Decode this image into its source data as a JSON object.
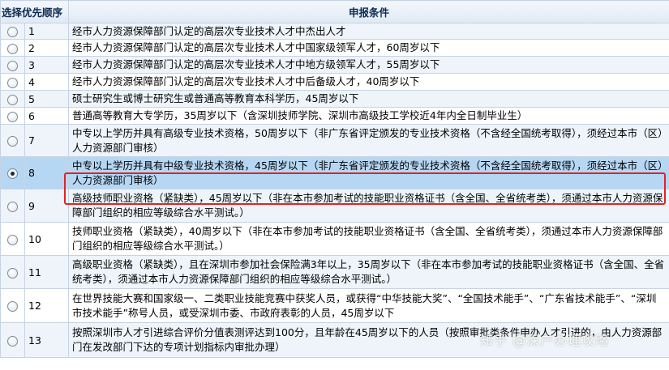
{
  "headers": {
    "select": "选择",
    "order": "优先顺序",
    "conditions": "申报条件"
  },
  "rows": [
    {
      "order": "1",
      "text": "经市人力资源保障部门认定的高层次专业技术人才中杰出人才",
      "selected": false
    },
    {
      "order": "2",
      "text": "经市人力资源保障部门认定的高层次专业技术人才中国家级领军人才，60周岁以下",
      "selected": false
    },
    {
      "order": "3",
      "text": "经市人力资源保障部门认定的高层次专业技术人才中地方级领军人才，55周岁以下",
      "selected": false
    },
    {
      "order": "4",
      "text": "经市人力资源保障部门认定的高层次专业技术人才中后备级人才，40周岁以下",
      "selected": false
    },
    {
      "order": "5",
      "text": "硕士研究生或博士研究生或普通高等教育本科学历，45周岁以下",
      "selected": false
    },
    {
      "order": "6",
      "text": "普通高等教育大专学历，35周岁以下（含深圳技师学院、深圳市高级技工学校近4年内全日制毕业生）",
      "selected": false
    },
    {
      "order": "7",
      "text": "中专以上学历并具有高级专业技术资格，50周岁以下（非广东省评定颁发的专业技术资格（不含经全国统考取得），须经过本市（区）人力资源部门审核）",
      "selected": false
    },
    {
      "order": "8",
      "text": "中专以上学历并具有中级专业技术资格，45周岁以下（非广东省评定颁发的专业技术资格（不含经全国统考取得），须经过本市（区）人力资源部门审核）",
      "selected": true
    },
    {
      "order": "9",
      "text": "高级技师职业资格（紧缺类），45周岁以下（非在本市参加考试的技能职业资格证书（含全国、全省统考类），须通过本市人力资源保障部门组织的相应等级综合水平测试。）",
      "selected": false
    },
    {
      "order": "10",
      "text": "技师职业资格（紧缺类），40周岁以下（非在本市参加考试的技能职业资格证书（含全国、全省统考类），须通过本市人力资源保障部门组织的相应等级综合水平测试。）",
      "selected": false
    },
    {
      "order": "11",
      "text": "高级职业资格（紧缺类），且在深圳市参加社会保险满3年以上，35周岁以下（非在本市参加考试的技能职业资格证书（含全国、全省统考类），须通过本市人力资源保障部门组织的相应等级综合水平测试。）",
      "selected": false
    },
    {
      "order": "12",
      "text": "在世界技能大赛和国家级一、二类职业技能竞赛中获奖人员，或获得“中华技能大奖”、“全国技术能手”、“广东省技术能手”、“深圳市技术能手”称号人员，或受深圳市委、市政府表彰的人员，45周岁以下",
      "selected": false
    },
    {
      "order": "13",
      "text": "按照深圳市人才引进综合评价分值表测评达到100分，且年龄在45周岁以下的人员（按照审批类条件申办人才引进的，由人力资源部门在发改部门下达的专项计划指标内审批办理）",
      "selected": false
    }
  ],
  "watermark": "知乎 @深户办理攻略",
  "highlight_color": "#e02424"
}
